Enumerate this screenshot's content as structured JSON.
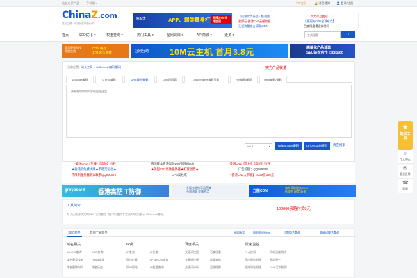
{
  "topbar": {
    "left1": "站长之家产品 ▾",
    "left2": "手机版 ▾",
    "vip": "VIP会员",
    "msg": "消息通知",
    "user": "登录/注册"
  },
  "header": {
    "logo_main": "China",
    "logo_z": "Z",
    "logo_dom": ".com",
    "logo_sub": "站长工具 · 为站长做事的伙伴",
    "ad_brand": "安卫士",
    "ad_main": "APP、端类量身打造",
    "ad_side": "无视攻击 全球加速",
    "links": [
      "《佳答实力高佳》铁流量",
      "实力产品变现",
      "易探云·香港CN2云服务器",
      "【真高防CDN全球布点】",
      "无视流量攻击 高防CDN",
      "百度网盘提速体验网"
    ]
  },
  "nav": {
    "items": [
      "首页",
      "SEO优化 ▾",
      "权重查询 ▾",
      "热门工具 ▾",
      "星网词库 ▾",
      "API商城 ▾",
      "更多 ▾"
    ],
    "search_placeholder": "工具搜索",
    "search_icon": "search-icon"
  },
  "banners": {
    "b1_line1": "亚马逊云科技",
    "b1_line2": "免费使用",
    "b1_big1": "CDN 每月",
    "b1_big2": "1TB 永久免费",
    "b2_brand": "冠网互动",
    "b2_big": "10M云主机  首月3.8元",
    "b3_line1": "高稿化产品诚邀",
    "b3_line2": "SEO站长合作 @pikaqo"
  },
  "panel": {
    "crumb": [
      "当前位置：",
      "站长工具",
      "UrlEncode编码/解码"
    ],
    "promo": "实力产品收量",
    "tabs": [
      "Unicode编码",
      "UTF-8编码",
      "URL编码/解码",
      "Unix时间戳",
      "Ascii/Native编码互转",
      "Hex编码/解码",
      "Html编码/解码"
    ],
    "active_tab": 2,
    "textarea_placeholder": "请将要转换的内容粘贴在这里",
    "select_value": "utf-8",
    "btn_encode": "UrlEncode编码",
    "btn_decode": "UrlDecode解码",
    "btn_clear": "清空结果"
  },
  "adlinks": [
    "*美国CN2【专线】【高防】秒开",
    "韩国日本香港高防vps/物理机cdn",
    "*美国CN2【专线】【高防】秒开",
    "★香港云免费试用★不稳定包退★",
    "★美国CN2高防服务器★打死退款★",
    "广告招租：QQ989335",
    "不限制服务器测试联系QQ800076",
    "CPS高分成",
    "【香港CN2大带宽】100M仅350元"
  ],
  "bottom_banners": {
    "b4_left": "greybeard",
    "b4_right": "香港高防 T防御",
    "b5_line1": "多服务器独享运营商",
    "b5_line2": "不限流量 全球节点",
    "b6_left": "万能CDN",
    "b6_line1": "海外高防服务CDN",
    "b6_line2": "抗攻击 稳定 高速"
  },
  "intro": {
    "title": "工具简介",
    "desc": "为了让包含中文的URL可以使用，您可以使用本工具对中文进行UrlEncode编码。",
    "ad": "100000买路付货8元"
  },
  "related": {
    "tabs": [
      "SEO相关",
      "其他工具相关"
    ],
    "links": [
      "网站备案",
      "网站测速Ping",
      "过期域名查询",
      "关键词排名查询"
    ],
    "columns": [
      {
        "title": "域名相关",
        "items": [
          "WHOIS查询",
          "DNS查询",
          "域名备案查询",
          "Hosts查询",
          "域名删除时间",
          "域名历史"
        ]
      },
      {
        "title": "IP类",
        "items": [
          "IP查询",
          "IP反查",
          "国内IP段",
          "IP WHOIS查询",
          "同IP网站",
          "IP批量查询"
        ]
      },
      {
        "title": "百度相关",
        "items": [
          "关键词挖掘",
          "百度权重",
          "长尾词挖掘",
          "收录查询",
          "关键词分析",
          "百度指数"
        ]
      },
      {
        "title": "测速/监控",
        "items": [
          "Ping检测",
          "网站速度测试",
          "国内网站测速",
          "网站历史",
          "国外网站测速",
          "DNS污染检测"
        ]
      }
    ]
  },
  "float": {
    "badge_text": "站长工具",
    "items": [
      {
        "label": "个人中心",
        "icon": "user-icon"
      },
      {
        "label": "意见反馈",
        "icon": "feedback-icon"
      },
      {
        "label": "客服",
        "icon": "service-icon"
      }
    ]
  }
}
